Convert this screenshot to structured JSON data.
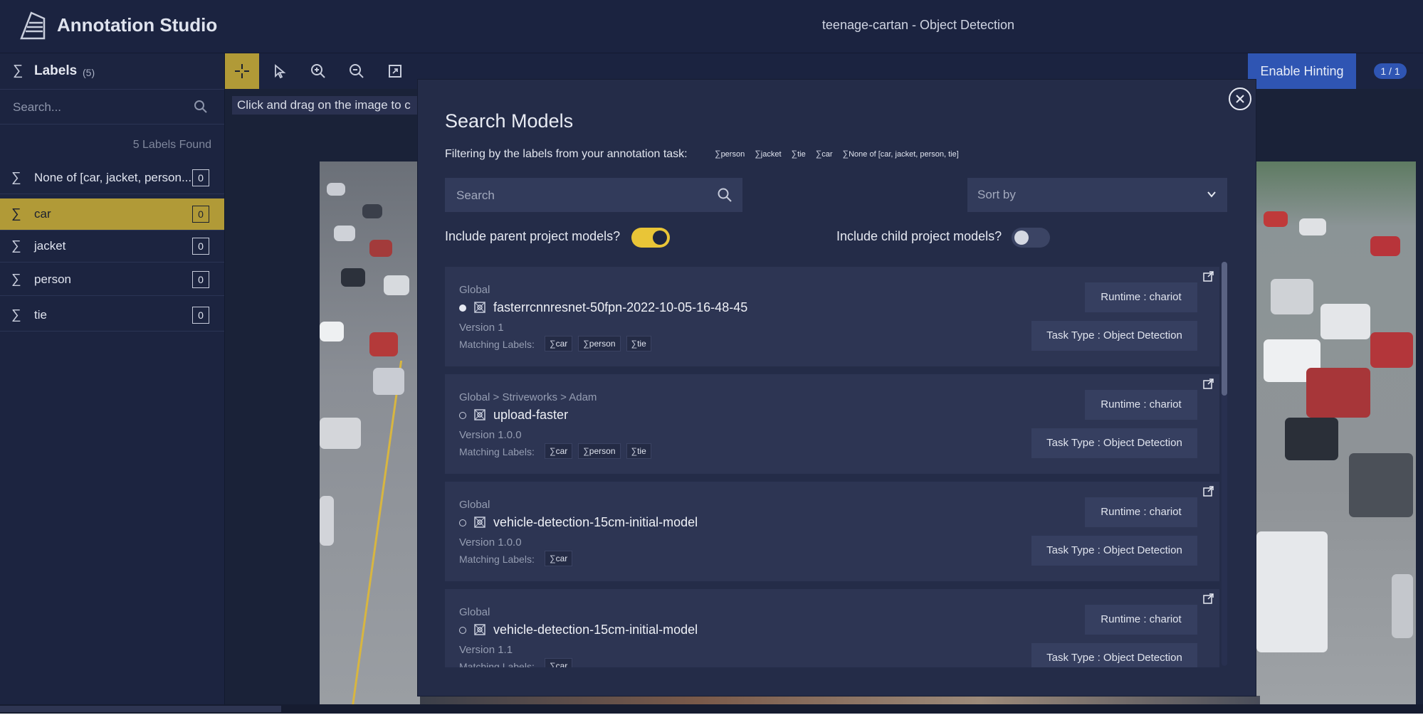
{
  "header": {
    "app_title": "Annotation Studio",
    "project_title": "teenage-cartan - Object Detection"
  },
  "sidebar": {
    "title": "Labels",
    "count": "(5)",
    "search_placeholder": "Search...",
    "found_text": "5 Labels Found",
    "labels": [
      {
        "name": "None of [car, jacket, person...",
        "count": "0",
        "active": false
      },
      {
        "name": "car",
        "count": "0",
        "active": true
      },
      {
        "name": "jacket",
        "count": "0",
        "active": false
      },
      {
        "name": "person",
        "count": "0",
        "active": false
      },
      {
        "name": "tie",
        "count": "0",
        "active": false
      }
    ]
  },
  "toolbar": {
    "tools": [
      "crosshair-icon",
      "pointer-icon",
      "zoom-in-icon",
      "zoom-out-icon",
      "fit-screen-icon"
    ],
    "enable_hinting": "Enable Hinting",
    "page_badge": "1 / 1",
    "instruction": "Click and drag on the image to c"
  },
  "modal": {
    "title": "Search Models",
    "filter_text": "Filtering by the labels from your annotation task:",
    "filter_labels": [
      "person",
      "jacket",
      "tie",
      "car",
      "None of [car, jacket, person, tie]"
    ],
    "search_placeholder": "Search",
    "sort_placeholder": "Sort by",
    "parent_toggle_label": "Include parent project models?",
    "parent_toggle_on": true,
    "child_toggle_label": "Include child project models?",
    "child_toggle_on": false,
    "models": [
      {
        "path": "Global",
        "name": "fasterrcnnresnet-50fpn-2022-10-05-16-48-45",
        "version": "Version 1",
        "matching_label": "Matching Labels:",
        "labels": [
          "car",
          "person",
          "tie"
        ],
        "runtime": "Runtime : chariot",
        "task_type": "Task Type : Object Detection",
        "selected": true
      },
      {
        "path": "Global > Striveworks > Adam",
        "name": "upload-faster",
        "version": "Version 1.0.0",
        "matching_label": "Matching Labels:",
        "labels": [
          "car",
          "person",
          "tie"
        ],
        "runtime": "Runtime : chariot",
        "task_type": "Task Type : Object Detection",
        "selected": false
      },
      {
        "path": "Global",
        "name": "vehicle-detection-15cm-initial-model",
        "version": "Version 1.0.0",
        "matching_label": "Matching Labels:",
        "labels": [
          "car"
        ],
        "runtime": "Runtime : chariot",
        "task_type": "Task Type : Object Detection",
        "selected": false
      },
      {
        "path": "Global",
        "name": "vehicle-detection-15cm-initial-model",
        "version": "Version 1.1",
        "matching_label": "Matching Labels:",
        "labels": [
          "car"
        ],
        "runtime": "Runtime : chariot",
        "task_type": "Task Type : Object Detection",
        "selected": false
      }
    ]
  },
  "colors": {
    "accent_yellow": "#b19a37",
    "toggle_on": "#e9c537",
    "primary_blue": "#2f55b3",
    "background": "#1a2238",
    "modal_background": "#242c48"
  }
}
